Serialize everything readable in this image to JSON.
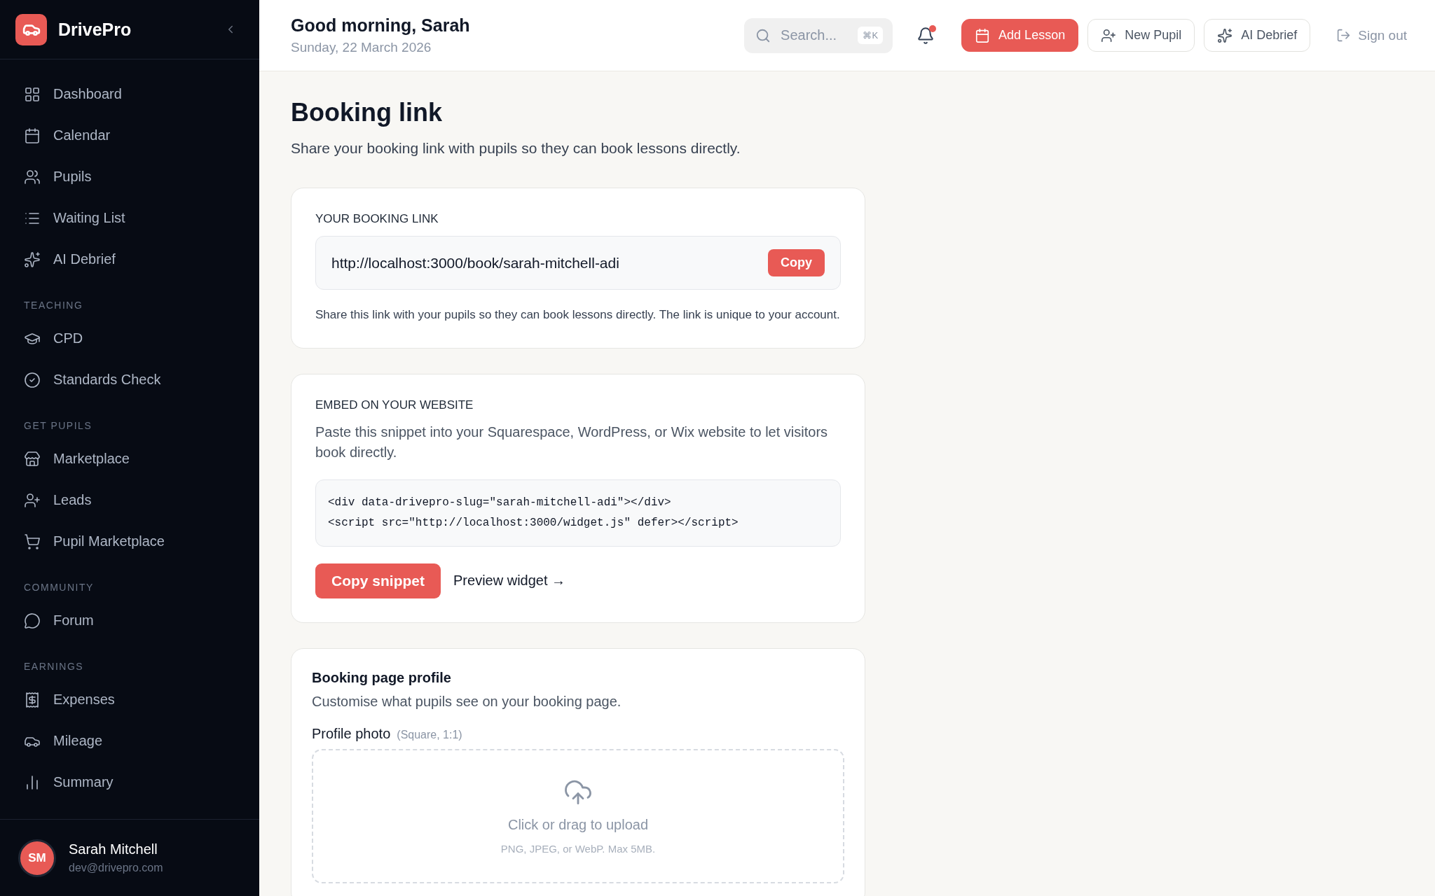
{
  "sidebar": {
    "brand": "DrivePro",
    "sections": [
      {
        "items": [
          {
            "label": "Dashboard",
            "selected": false
          },
          {
            "label": "Calendar",
            "selected": false
          },
          {
            "label": "Pupils",
            "selected": false
          },
          {
            "label": "Waiting List",
            "selected": false
          },
          {
            "label": "AI Debrief",
            "selected": false
          }
        ]
      },
      {
        "label": "TEACHING",
        "items": [
          {
            "label": "CPD",
            "selected": false
          },
          {
            "label": "Standards Check",
            "selected": false
          }
        ]
      },
      {
        "label": "GET PUPILS",
        "items": [
          {
            "label": "Marketplace",
            "selected": false
          },
          {
            "label": "Leads",
            "selected": false
          },
          {
            "label": "Pupil Marketplace",
            "selected": false
          }
        ]
      },
      {
        "label": "COMMUNITY",
        "items": [
          {
            "label": "Forum",
            "selected": false
          }
        ]
      },
      {
        "label": "EARNINGS",
        "items": [
          {
            "label": "Expenses",
            "selected": false
          },
          {
            "label": "Mileage",
            "selected": false
          },
          {
            "label": "Summary",
            "selected": false
          }
        ]
      }
    ],
    "user": {
      "initials": "SM",
      "name": "Sarah Mitchell",
      "email": "dev@drivepro.com"
    }
  },
  "header": {
    "greeting": "Good morning, Sarah",
    "date": "Sunday, 22 March 2026",
    "search": {
      "placeholder": "Search...",
      "shortcut": "⌘K"
    },
    "notifications_unread": true,
    "buttons": [
      {
        "label": "Add Lesson",
        "kind": "primary"
      },
      {
        "label": "New Pupil",
        "kind": "outline"
      },
      {
        "label": "AI Debrief",
        "kind": "outline"
      }
    ],
    "sign_out": "Sign out"
  },
  "page": {
    "title": "Booking link",
    "subtitle": "Share your booking link with pupils so they can book lessons directly."
  },
  "booking_card": {
    "heading": "YOUR BOOKING LINK",
    "link": "http://localhost:3000/book/sarah-mitchell-adi",
    "copy_button": "Copy",
    "note": "Share this link with your pupils so they can book lessons directly. The link is unique to your account."
  },
  "embed_card": {
    "heading": "EMBED ON YOUR WEBSITE",
    "description": "Paste this snippet into your Squarespace, WordPress, or Wix website to let visitors book directly.",
    "code_lines": [
      "<div data-drivepro-slug=\"sarah-mitchell-adi\"></div>",
      "<script src=\"http://localhost:3000/widget.js\" defer></script>"
    ],
    "copy_button": "Copy snippet",
    "preview_link": "Preview widget →"
  },
  "profile_card": {
    "heading": "Booking page profile",
    "description": "Customise what pupils see on your booking page.",
    "photo_label": "Profile photo",
    "photo_hint": "(Square, 1:1)",
    "upload_text": "Click or drag to upload",
    "upload_hint": "PNG, JPEG, or WebP. Max 5MB."
  }
}
